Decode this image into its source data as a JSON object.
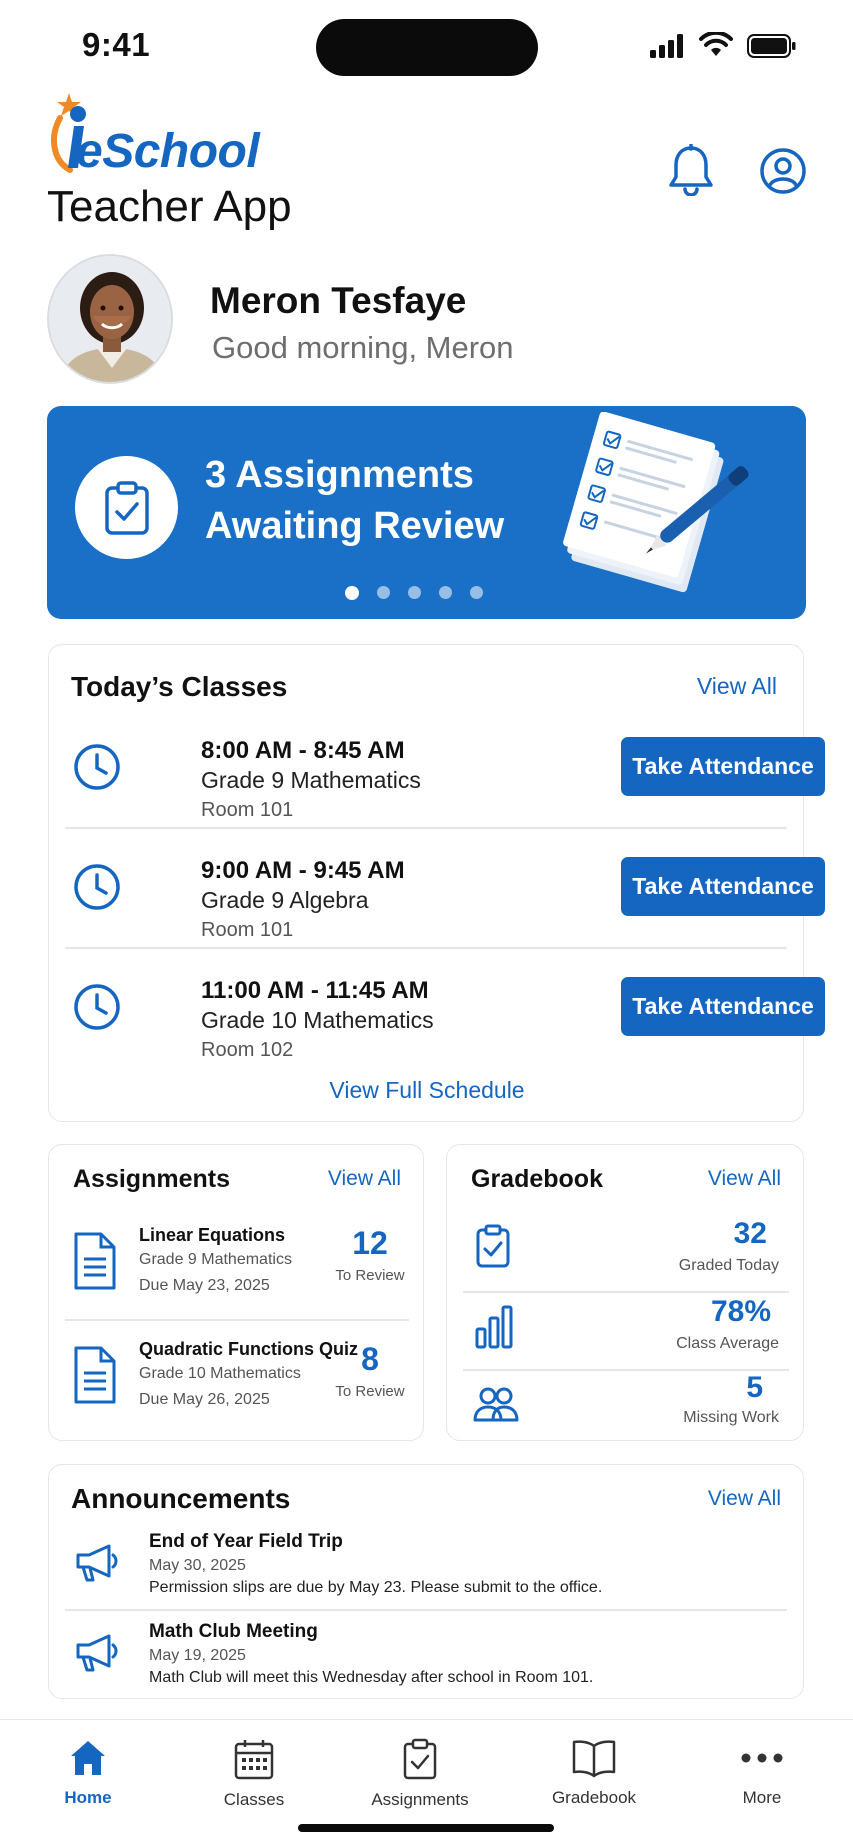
{
  "status_bar": {
    "time": "9:41"
  },
  "header": {
    "logo_text": "eSchool",
    "app_title": "Teacher App",
    "icons": [
      "bell-icon",
      "user-circle-icon"
    ]
  },
  "user": {
    "name": "Meron Tesfaye",
    "greeting": "Good morning, Meron"
  },
  "banner": {
    "title": "3 Assignments Awaiting Review",
    "slide_count": 5,
    "active_slide": 1,
    "color": "#1a6fc6"
  },
  "todays_classes": {
    "title": "Today’s Classes",
    "view_all": "View All",
    "items": [
      {
        "time": "8:00 AM - 8:45 AM",
        "name": "Grade 9 Mathematics",
        "room": "Room 101",
        "button": "Take Attendance"
      },
      {
        "time": "9:00 AM - 9:45 AM",
        "name": "Grade 9 Algebra",
        "room": "Room 101",
        "button": "Take Attendance"
      },
      {
        "time": "11:00 AM - 11:45 AM",
        "name": "Grade 10 Mathematics",
        "room": "Room 102",
        "button": "Take Attendance"
      }
    ],
    "full_schedule": "View Full Schedule"
  },
  "assignments": {
    "title": "Assignments",
    "view_all": "View All",
    "items": [
      {
        "title": "Linear Equations",
        "class": "Grade 9 Mathematics",
        "due": "Due May 23, 2025",
        "count": "12",
        "count_label": "To Review"
      },
      {
        "title": "Quadratic Functions Quiz",
        "class": "Grade 10 Mathematics",
        "due": "Due May 26, 2025",
        "count": "8",
        "count_label": "To Review"
      }
    ]
  },
  "gradebook": {
    "title": "Gradebook",
    "view_all": "View All",
    "stats": [
      {
        "icon": "clipboard-check-icon",
        "value": "32",
        "label": "Graded Today"
      },
      {
        "icon": "bar-chart-icon",
        "value": "78%",
        "label": "Class Average"
      },
      {
        "icon": "users-icon",
        "value": "5",
        "label": "Missing Work"
      }
    ]
  },
  "announcements": {
    "title": "Announcements",
    "view_all": "View All",
    "items": [
      {
        "title": "End of Year Field Trip",
        "date": "May 30, 2025",
        "body": "Permission slips are due by May 23. Please submit to the office."
      },
      {
        "title": "Math Club Meeting",
        "date": "May 19, 2025",
        "body": "Math Club will meet this Wednesday after school in Room 101."
      }
    ]
  },
  "nav": {
    "items": [
      {
        "label": "Home",
        "icon": "home-icon",
        "active": true
      },
      {
        "label": "Classes",
        "icon": "calendar-icon",
        "active": false
      },
      {
        "label": "Assignments",
        "icon": "clipboard-icon",
        "active": false
      },
      {
        "label": "Gradebook",
        "icon": "book-icon",
        "active": false
      },
      {
        "label": "More",
        "icon": "more-dots-icon",
        "active": false
      }
    ]
  },
  "colors": {
    "primary": "#1566c0",
    "accent": "#f08a24"
  }
}
